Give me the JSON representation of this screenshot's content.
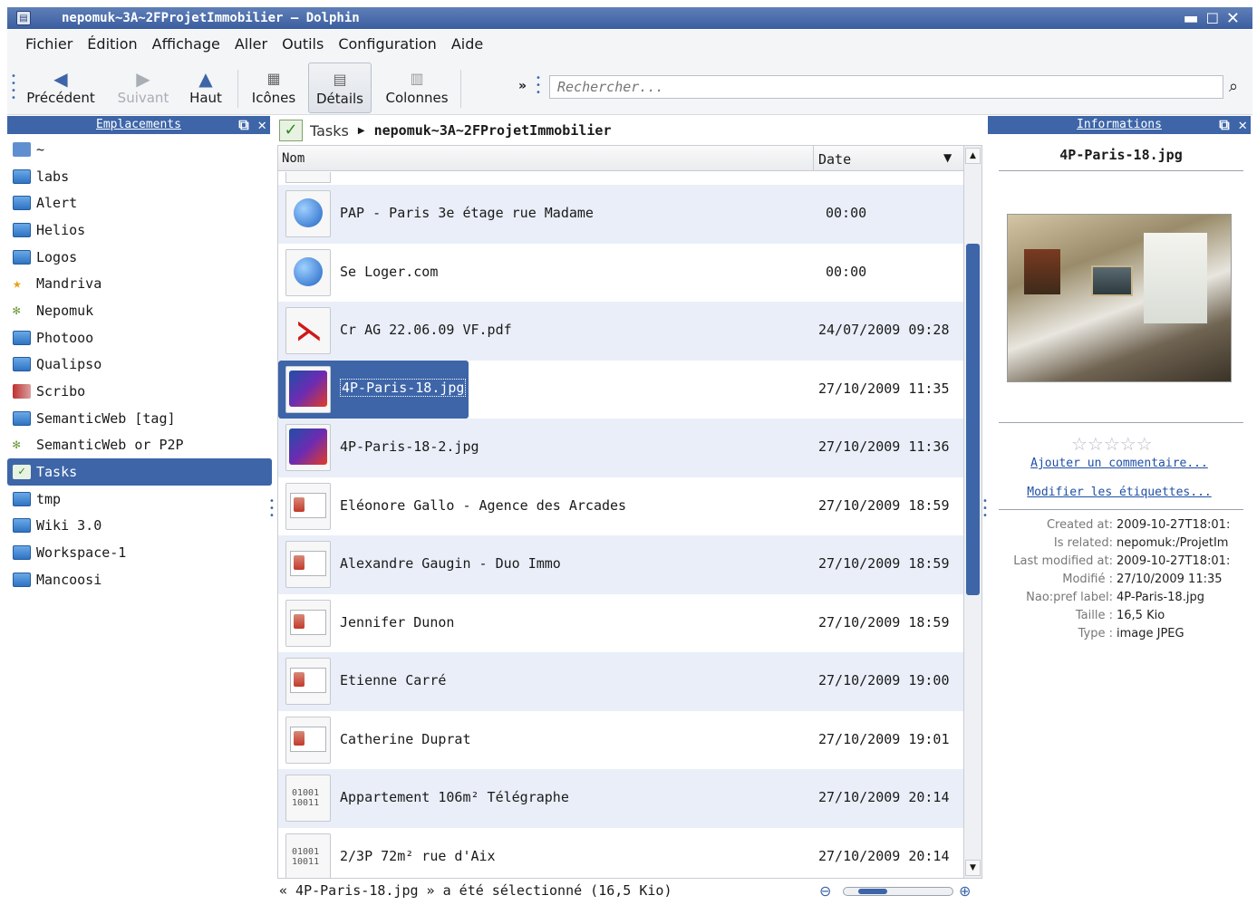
{
  "window": {
    "title": "nepomuk~3A~2FProjetImmobilier – Dolphin",
    "controls": [
      "▬",
      "☐",
      "✕"
    ]
  },
  "menu": [
    "Fichier",
    "Édition",
    "Affichage",
    "Aller",
    "Outils",
    "Configuration",
    "Aide"
  ],
  "toolbar": {
    "back": "Précédent",
    "forward": "Suivant",
    "up": "Haut",
    "icons": "Icônes",
    "details": "Détails",
    "columns": "Colonnes",
    "more": "»",
    "search_placeholder": "Rechercher..."
  },
  "places": {
    "title": "Emplacements",
    "items": [
      {
        "label": "~",
        "icon": "home-icon"
      },
      {
        "label": "labs",
        "icon": "network-folder-icon"
      },
      {
        "label": "Alert",
        "icon": "folder-icon"
      },
      {
        "label": "Helios",
        "icon": "folder-icon"
      },
      {
        "label": "Logos",
        "icon": "folder-icon"
      },
      {
        "label": "Mandriva",
        "icon": "star-icon"
      },
      {
        "label": "Nepomuk",
        "icon": "nepomuk-icon"
      },
      {
        "label": "Photooo",
        "icon": "folder-icon"
      },
      {
        "label": "Qualipso",
        "icon": "folder-icon"
      },
      {
        "label": "Scribo",
        "icon": "scribo-icon"
      },
      {
        "label": "SemanticWeb [tag]",
        "icon": "folder-icon"
      },
      {
        "label": "SemanticWeb or P2P",
        "icon": "nepomuk-icon"
      },
      {
        "label": "Tasks",
        "icon": "tasks-icon",
        "selected": true
      },
      {
        "label": "tmp",
        "icon": "folder-icon"
      },
      {
        "label": "Wiki 3.0",
        "icon": "folder-icon"
      },
      {
        "label": "Workspace-1",
        "icon": "folder-icon"
      },
      {
        "label": "Mancoosi",
        "icon": "folder-icon"
      }
    ]
  },
  "breadcrumb": {
    "root": "Tasks",
    "current": "nepomuk~3A~2FProjetImmobilier"
  },
  "columns": {
    "name": "Nom",
    "date": "Date"
  },
  "files": [
    {
      "name": "PAP - Paris 3e étage rue Madame",
      "date": "00:00",
      "type": "web"
    },
    {
      "name": "Se Loger.com",
      "date": "00:00",
      "type": "web"
    },
    {
      "name": "Cr AG 22.06.09 VF.pdf",
      "date": "24/07/2009 09:28",
      "type": "pdf"
    },
    {
      "name": "4P-Paris-18.jpg",
      "date": "27/10/2009 11:35",
      "type": "image",
      "selected": true
    },
    {
      "name": "4P-Paris-18-2.jpg",
      "date": "27/10/2009 11:36",
      "type": "image"
    },
    {
      "name": "Eléonore Gallo - Agence des Arcades",
      "date": "27/10/2009 18:59",
      "type": "contact"
    },
    {
      "name": "Alexandre Gaugin - Duo Immo",
      "date": "27/10/2009 18:59",
      "type": "contact"
    },
    {
      "name": "Jennifer Dunon",
      "date": "27/10/2009 18:59",
      "type": "contact"
    },
    {
      "name": "Etienne Carré",
      "date": "27/10/2009 19:00",
      "type": "contact"
    },
    {
      "name": "Catherine Duprat",
      "date": "27/10/2009 19:01",
      "type": "contact"
    },
    {
      "name": "Appartement 106m² Télégraphe",
      "date": "27/10/2009 20:14",
      "type": "binary"
    },
    {
      "name": "2/3P 72m² rue d'Aix",
      "date": "27/10/2009 20:14",
      "type": "binary"
    }
  ],
  "status": "« 4P-Paris-18.jpg » a été sélectionné (16,5 Kio)",
  "info": {
    "title": "Informations",
    "filename": "4P-Paris-18.jpg",
    "rating_stars": "☆☆☆☆☆",
    "add_comment": "Ajouter un commentaire...",
    "edit_tags": "Modifier les étiquettes...",
    "meta": [
      {
        "k": "Created at:",
        "v": "2009-10-27T18:01:"
      },
      {
        "k": "Is related:",
        "v": "nepomuk:/ProjetIm"
      },
      {
        "k": "Last modified at:",
        "v": "2009-10-27T18:01:"
      },
      {
        "k": "Modifié :",
        "v": "27/10/2009 11:35"
      },
      {
        "k": "Nao:pref label:",
        "v": "4P-Paris-18.jpg"
      },
      {
        "k": "Taille :",
        "v": "16,5 Kio"
      },
      {
        "k": "Type :",
        "v": "image JPEG"
      }
    ]
  }
}
